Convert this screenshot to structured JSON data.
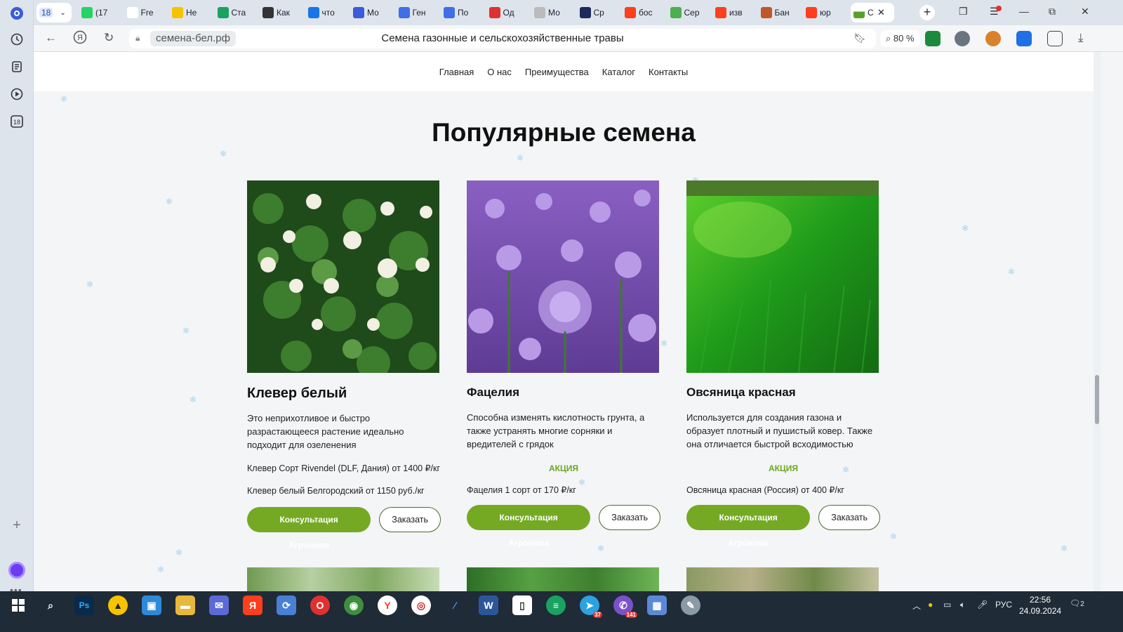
{
  "browser": {
    "tab_count_label": "18",
    "tabs": [
      {
        "label": "(17",
        "icon": "whatsapp-icon",
        "color": "#25d366"
      },
      {
        "label": "Fre",
        "icon": "document-icon",
        "color": "#ffffff"
      },
      {
        "label": "Не",
        "icon": "beeline-icon",
        "color": "#f5c300"
      },
      {
        "label": "Ста",
        "icon": "sheets-icon",
        "color": "#1aa260"
      },
      {
        "label": "Как",
        "icon": "link-icon",
        "color": "#333333"
      },
      {
        "label": "что",
        "icon": "g-icon",
        "color": "#1a73e8"
      },
      {
        "label": "Мо",
        "icon": "forms-icon",
        "color": "#3b5bdb"
      },
      {
        "label": "Ген",
        "icon": "play-icon",
        "color": "#3f6ee8"
      },
      {
        "label": "По",
        "icon": "play-icon",
        "color": "#3f6ee8"
      },
      {
        "label": "Од",
        "icon": "pdf-icon",
        "color": "#e03131"
      },
      {
        "label": "Мо",
        "icon": "loading-icon",
        "color": "#bbbbbb"
      },
      {
        "label": "Ср",
        "icon": "p-icon",
        "color": "#1e2a5a"
      },
      {
        "label": "бос",
        "icon": "yandex-icon",
        "color": "#fc3f1d"
      },
      {
        "label": "Сер",
        "icon": "sheet-icon",
        "color": "#4caf50"
      },
      {
        "label": "изв",
        "icon": "yandex-icon",
        "color": "#fc3f1d"
      },
      {
        "label": "Бан",
        "icon": "bank-icon",
        "color": "#c0562a"
      },
      {
        "label": "юр",
        "icon": "yandex-icon",
        "color": "#fc3f1d"
      }
    ],
    "active_tab": {
      "label": "С",
      "icon": "grass-icon",
      "color": "#5aa02c"
    },
    "url": "семена-бел.рф",
    "page_title": "Семена газонные и сельскохозяйственные травы",
    "zoom": "80 %"
  },
  "site": {
    "nav": [
      "Главная",
      "О нас",
      "Преимущества",
      "Каталог",
      "Контакты"
    ],
    "section_title": "Популярные семена",
    "sale_label": "АКЦИЯ",
    "consult_label": "Консультация Агронома",
    "order_label": "Заказать",
    "cards": [
      {
        "title": "Клевер белый",
        "desc": "Это неприхотливое и быстро разрастающееся растение идеально подходит для озеленения",
        "lines": [
          "Клевер Сорт Rivendel (DLF, Дания) от 1400 ₽/кг",
          "Клевер белый Белгородский от 1150 руб./кг"
        ],
        "image": "clover-photo"
      },
      {
        "title": "Фацелия",
        "desc": "Способна изменять кислотность грунта, а также устранять многие сорняки и вредителей с грядок",
        "lines": [
          "Фацелия 1 сорт от 170 ₽/кг"
        ],
        "image": "phacelia-photo"
      },
      {
        "title": "Овсяница красная",
        "desc": "Используется для создания газона и образует плотный и пушистый ковер. Также она отличается быстрой всходимостью",
        "lines": [
          "Овсяница красная (Россия) от 400 ₽/кг"
        ],
        "image": "fescue-photo"
      }
    ]
  },
  "taskbar": {
    "lang": "РУС",
    "time": "22:56",
    "date": "24.09.2024",
    "notifications": "2",
    "badge_telegram": "37",
    "badge_viber": "141"
  }
}
